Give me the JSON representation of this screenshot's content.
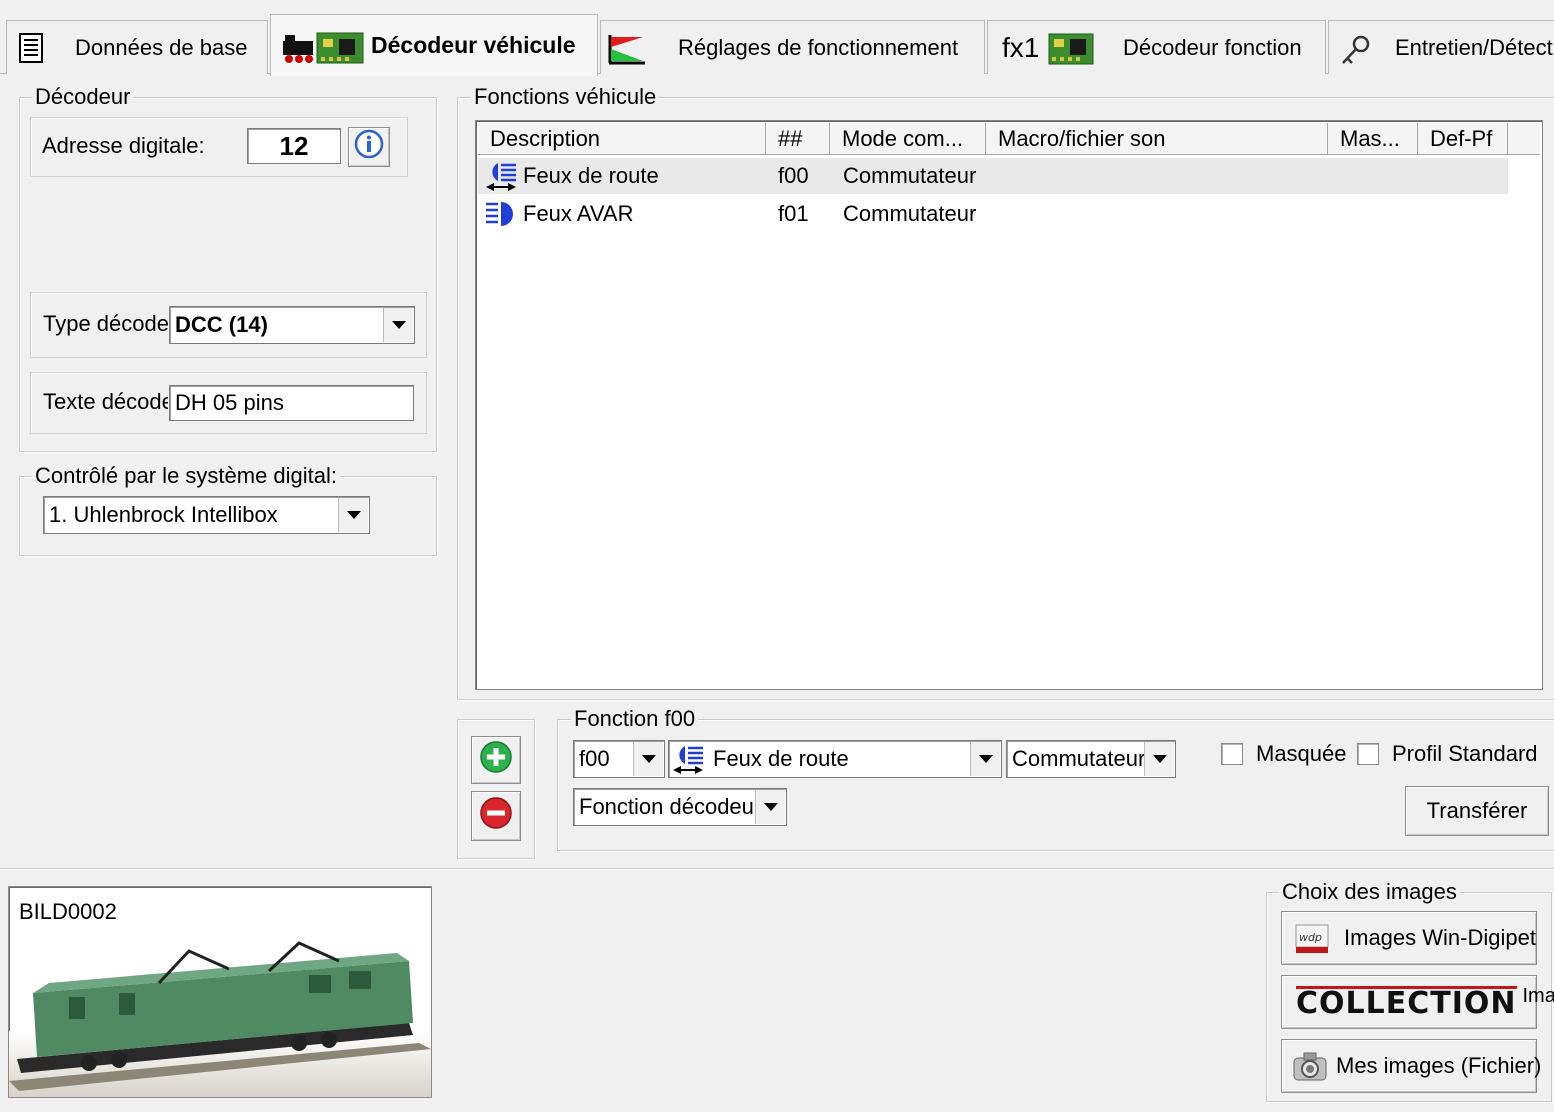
{
  "tabs": [
    {
      "id": "base",
      "label": "Données de base",
      "icon": "document-icon"
    },
    {
      "id": "vehicle",
      "label": "Décodeur véhicule",
      "icon": "locomotive-decoder-icon",
      "active": true
    },
    {
      "id": "settings",
      "label": "Réglages de fonctionnement",
      "icon": "speed-curve-icon"
    },
    {
      "id": "function",
      "label": "Décodeur fonction",
      "prefix": "fx1",
      "icon": "function-decoder-icon"
    },
    {
      "id": "maintenance",
      "label": "Entretien/Détect",
      "icon": "wrench-icon"
    }
  ],
  "decoder": {
    "legend": "Décodeur",
    "address_label": "Adresse digitale:",
    "address_value": "12",
    "type_label": "Type décode",
    "type_value": "DCC (14)",
    "text_label": "Texte décode",
    "text_value": "DH 05 pins"
  },
  "control": {
    "legend": "Contrôlé par le système digital:",
    "system_value": "1. Uhlenbrock Intellibox"
  },
  "functions": {
    "legend": "Fonctions véhicule",
    "columns": [
      "Description",
      "##",
      "Mode com...",
      "Macro/fichier son",
      "Mas...",
      "Def-Pf"
    ],
    "rows": [
      {
        "description": "Feux de route",
        "num": "f00",
        "mode": "Commutateur",
        "icon": "headlight-icon"
      },
      {
        "description": "Feux AVAR",
        "num": "f01",
        "mode": "Commutateur",
        "icon": "light-beam-icon"
      }
    ]
  },
  "function_edit": {
    "legend": "Fonction f00",
    "num_value": "f00",
    "desc_value": "Feux de route",
    "mode_value": "Commutateur",
    "type_value": "Fonction décodeu",
    "masked_label": "Masquée",
    "profile_label": "Profil Standard",
    "transfer_label": "Transférer"
  },
  "image": {
    "name": "BILD0002"
  },
  "images_group": {
    "legend": "Choix des images",
    "wdp_label": "Images Win-Digipet",
    "collection_logo": "COLLECTION",
    "collection_label": "Images",
    "mine_label": "Mes images (Fichier)"
  },
  "colors": {
    "accent_blue": "#1f3fd6",
    "add_green": "#2bb24c",
    "remove_red": "#d9262a"
  }
}
